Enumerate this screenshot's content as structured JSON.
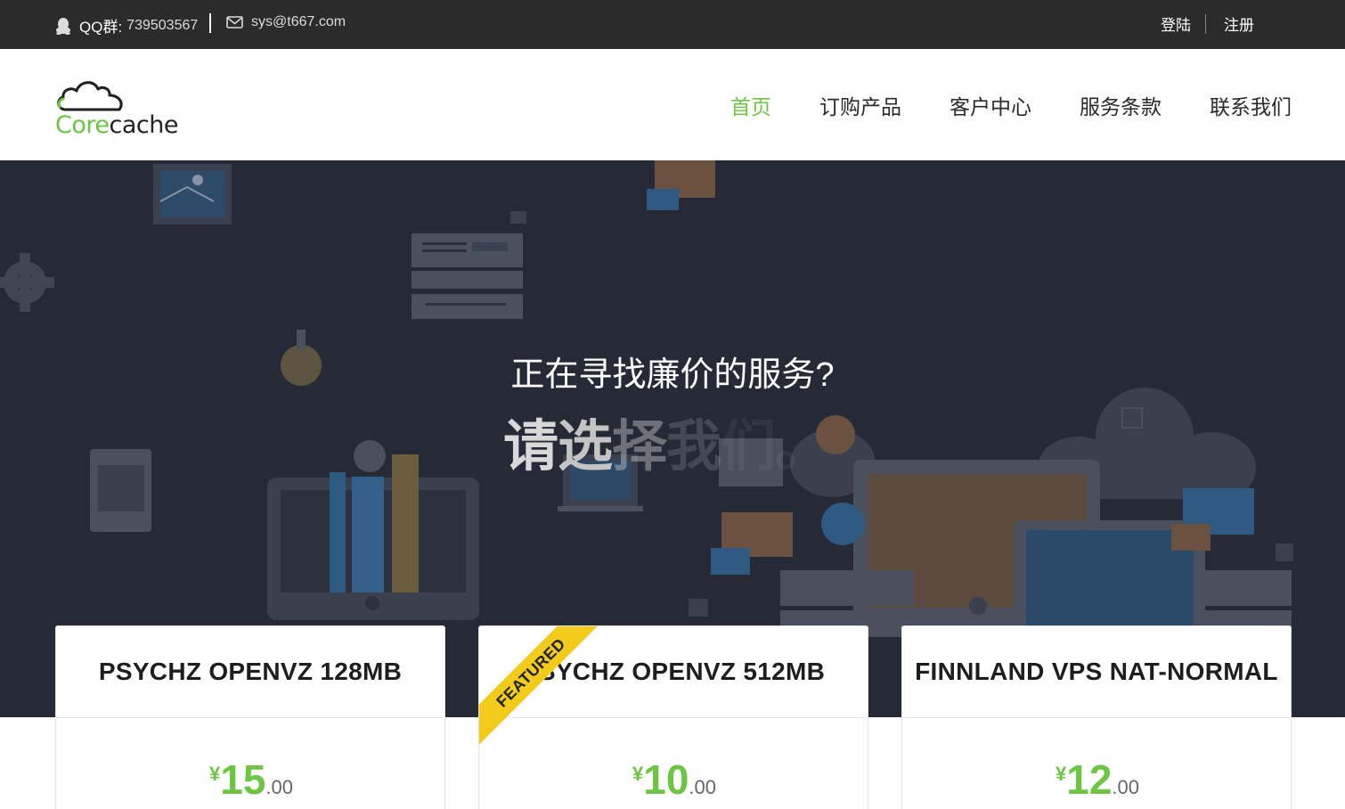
{
  "topbar": {
    "qq_label": "QQ群:",
    "qq_number": "739503567",
    "email": "sys@t667.com",
    "login": "登陆",
    "register": "注册"
  },
  "header": {
    "logo": {
      "part1": "Core",
      "part2": "cache"
    },
    "nav": [
      {
        "label": "首页",
        "active": true
      },
      {
        "label": "订购产品",
        "active": false
      },
      {
        "label": "客户中心",
        "active": false
      },
      {
        "label": "服务条款",
        "active": false
      },
      {
        "label": "联系我们",
        "active": false
      }
    ]
  },
  "hero": {
    "title": "正在寻找廉价的服务?",
    "subtitle_parts": [
      "请",
      "选",
      "择",
      "我",
      "们",
      "。"
    ]
  },
  "plans": [
    {
      "name": "PSYCHZ OPENVZ 128MB",
      "currency": "¥",
      "price_int": "15",
      "price_dec": ".00",
      "featured": false
    },
    {
      "name": "PSYCHZ OPENVZ 512MB",
      "currency": "¥",
      "price_int": "10",
      "price_dec": ".00",
      "featured": true,
      "badge": "FEATURED"
    },
    {
      "name": "FINNLAND VPS NAT-NORMAL",
      "currency": "¥",
      "price_int": "12",
      "price_dec": ".00",
      "featured": false
    }
  ],
  "colors": {
    "accent": "#6cc644",
    "topbar": "#2b2b2b",
    "hero_bg": "#252a36",
    "ribbon": "#f2cb1d"
  }
}
